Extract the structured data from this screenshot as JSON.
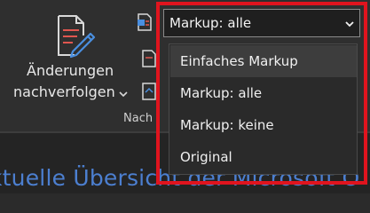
{
  "ribbon": {
    "track_changes": {
      "label_line1": "Änderungen",
      "label_line2": "nachverfolgen",
      "icon": "document-pencil-icon"
    },
    "group_label_visible": "Nach"
  },
  "markup": {
    "selected": "Markup: alle",
    "options": [
      {
        "label": "Einfaches Markup",
        "hovered": true
      },
      {
        "label": "Markup: alle",
        "hovered": false
      },
      {
        "label": "Markup: keine",
        "hovered": false
      },
      {
        "label": "Original",
        "hovered": false
      }
    ]
  },
  "document": {
    "heading_visible": "ktuelle Übersicht der Microsoft O"
  },
  "colors": {
    "highlight_border": "#e0141e",
    "heading_blue": "#4c7fd0",
    "icon_red": "#e0564f",
    "icon_blue": "#4a8fe0"
  }
}
